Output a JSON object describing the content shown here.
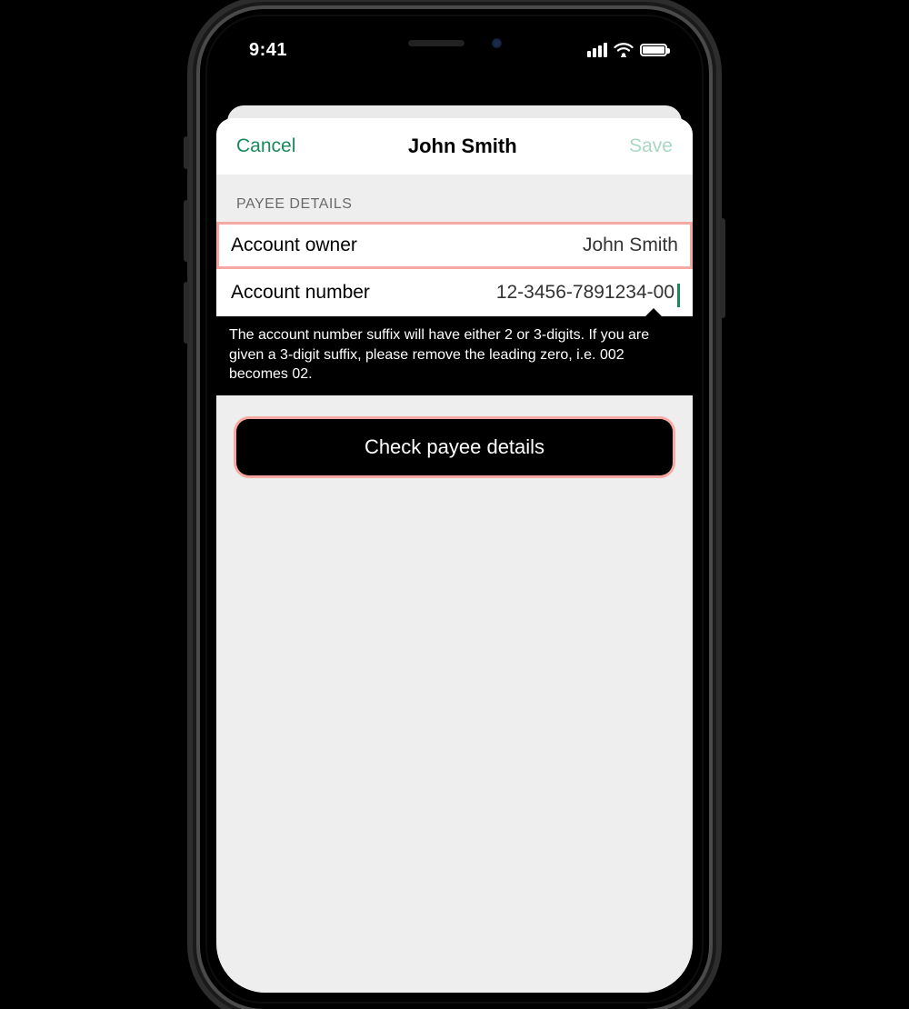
{
  "statusbar": {
    "time": "9:41"
  },
  "nav": {
    "cancel": "Cancel",
    "title": "John Smith",
    "save": "Save"
  },
  "section": {
    "header": "PAYEE DETAILS"
  },
  "fields": {
    "owner": {
      "label": "Account owner",
      "value": "John Smith"
    },
    "account": {
      "label": "Account number",
      "value": "12-3456-7891234-00"
    }
  },
  "tooltip": "The account number suffix will have either 2 or 3-digits. If you are given a 3-digit suffix, please remove the leading zero, i.e. 002 becomes 02.",
  "cta": {
    "label": "Check payee details"
  }
}
